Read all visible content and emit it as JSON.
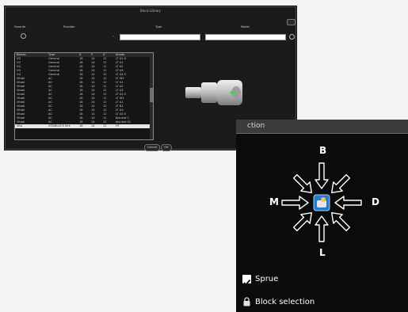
{
  "dialog": {
    "title": "Block Library",
    "headers": {
      "favorite": "Favorite",
      "provider": "Provider",
      "type": "Type",
      "model": "Model"
    },
    "type_value": "",
    "model_value": "",
    "table": {
      "columns": [
        "Blocks",
        "Type",
        "X",
        "Y",
        "Z",
        "Shade"
      ],
      "rows": [
        [
          "VG",
          "General",
          "18",
          "14",
          "12",
          "LT A1.0"
        ],
        [
          "VG",
          "General",
          "18",
          "14",
          "12",
          "LT A1"
        ],
        [
          "VG",
          "General",
          "18",
          "14",
          "12",
          "LT A2"
        ],
        [
          "VG",
          "General",
          "18",
          "14",
          "12",
          "LT A3"
        ],
        [
          "VG",
          "General",
          "18",
          "14",
          "12",
          "LT A3.5"
        ],
        [
          "Vitabl",
          "AC",
          "18",
          "14",
          "12",
          "LT W2"
        ],
        [
          "Vitabl",
          "AC",
          "18",
          "14",
          "12",
          "LT A1"
        ],
        [
          "Vitabl",
          "AC",
          "18",
          "14",
          "12",
          "LT A2"
        ],
        [
          "Vitabl",
          "AC",
          "18",
          "14",
          "12",
          "LT A3"
        ],
        [
          "Vitabl",
          "AC",
          "18",
          "14",
          "12",
          "LT A3.5"
        ],
        [
          "Vitabl",
          "AC",
          "18",
          "14",
          "12",
          "LT W1"
        ],
        [
          "Vitabl",
          "AC",
          "18",
          "14",
          "12",
          "LT A1"
        ],
        [
          "Vitabl",
          "AC",
          "18",
          "14",
          "12",
          "LT B1"
        ],
        [
          "Vitabl",
          "AC",
          "18",
          "14",
          "12",
          "LT A3"
        ],
        [
          "Vitabl",
          "AC",
          "18",
          "14",
          "12",
          "LT A3.5"
        ],
        [
          "Vitabl",
          "AC",
          "18",
          "14",
          "12",
          "blanket C"
        ],
        [
          "Vitabl",
          "AC",
          "18",
          "14",
          "12",
          "blanket SC"
        ],
        [
          "Vita",
          "VITABLOCS Mrk",
          "18",
          "14",
          "12",
          "HT"
        ]
      ],
      "selected_index": 17
    },
    "cancel_label": "Cancel",
    "ok_label": "OK"
  },
  "panel": {
    "title": "ction",
    "labels": {
      "top": "B",
      "left": "M",
      "right": "D",
      "bottom": "L"
    },
    "sprue_label": "Sprue",
    "sprue_checked": true,
    "block_selection_label": "Block selection"
  },
  "colors": {
    "dialog_bg": "#1b1b1b",
    "panel_bg": "#0b0b0b",
    "accent_blue": "#2d79c7"
  },
  "icons": {
    "favorite": "star-icon",
    "refresh": "refresh-icon",
    "close": "close-icon",
    "center": "block-orientation-icon",
    "lock": "lock-icon",
    "check": "checkbox-icon"
  }
}
